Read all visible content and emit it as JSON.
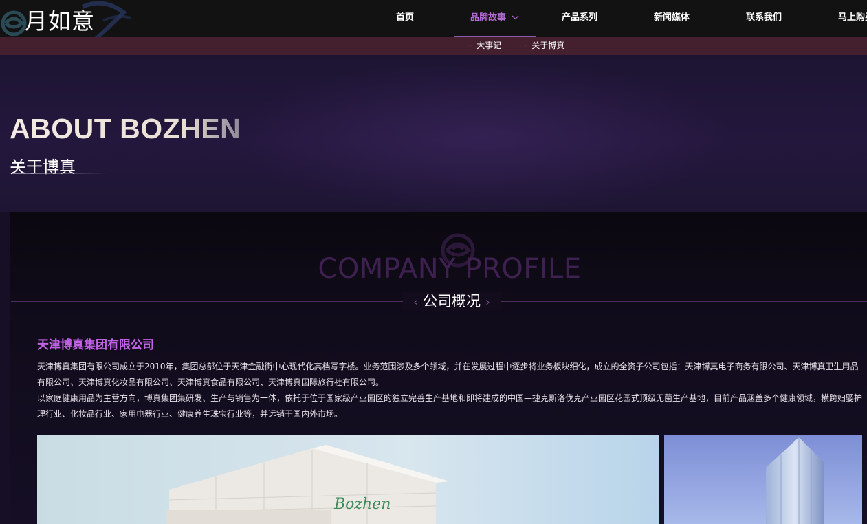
{
  "header": {
    "logo_text": "月如意",
    "nav": [
      {
        "label": "首页",
        "active": false
      },
      {
        "label": "品牌故事",
        "active": true,
        "has_dropdown": true
      },
      {
        "label": "产品系列",
        "active": false
      },
      {
        "label": "新闻媒体",
        "active": false
      },
      {
        "label": "联系我们",
        "active": false
      },
      {
        "label": "马上购买",
        "active": false
      }
    ],
    "subnav": [
      "大事记",
      "关于博真"
    ]
  },
  "hero": {
    "title": "ABOUT BOZHEN",
    "subtitle": "关于博真"
  },
  "section": {
    "title_en": "COMPANY PROFILE",
    "title_cn": "公司概况",
    "company_name": "天津博真集团有限公司",
    "paragraph_1": "天津博真集团有限公司成立于2010年，集团总部位于天津金融街中心现代化高档写字楼。业务范围涉及多个领域，并在发展过程中逐步将业务板块细化，成立的全资子公司包括：天津博真电子商务有限公司、天津博真卫生用品有限公司、天津博真化妆品有限公司、天津博真食品有限公司、天津博真国际旅行社有限公司。",
    "paragraph_2": "以家庭健康用品为主营方向，博真集团集研发、生产与销售为一体，依托于位于国家级产业园区的独立完善生产基地和即将建成的中国—捷克斯洛伐克产业园区花园式顶级无菌生产基地，目前产品涵盖多个健康领域，横跨妇婴护理行业、化妆品行业、家用电器行业、健康养生珠宝行业等，并远销于国内外市场。",
    "factory_sign": "Bozhen"
  },
  "colors": {
    "accent_purple": "#c263e6",
    "nav_active": "#b569d6",
    "subnav_bg": "#44202f",
    "page_bg": "#160f26"
  }
}
